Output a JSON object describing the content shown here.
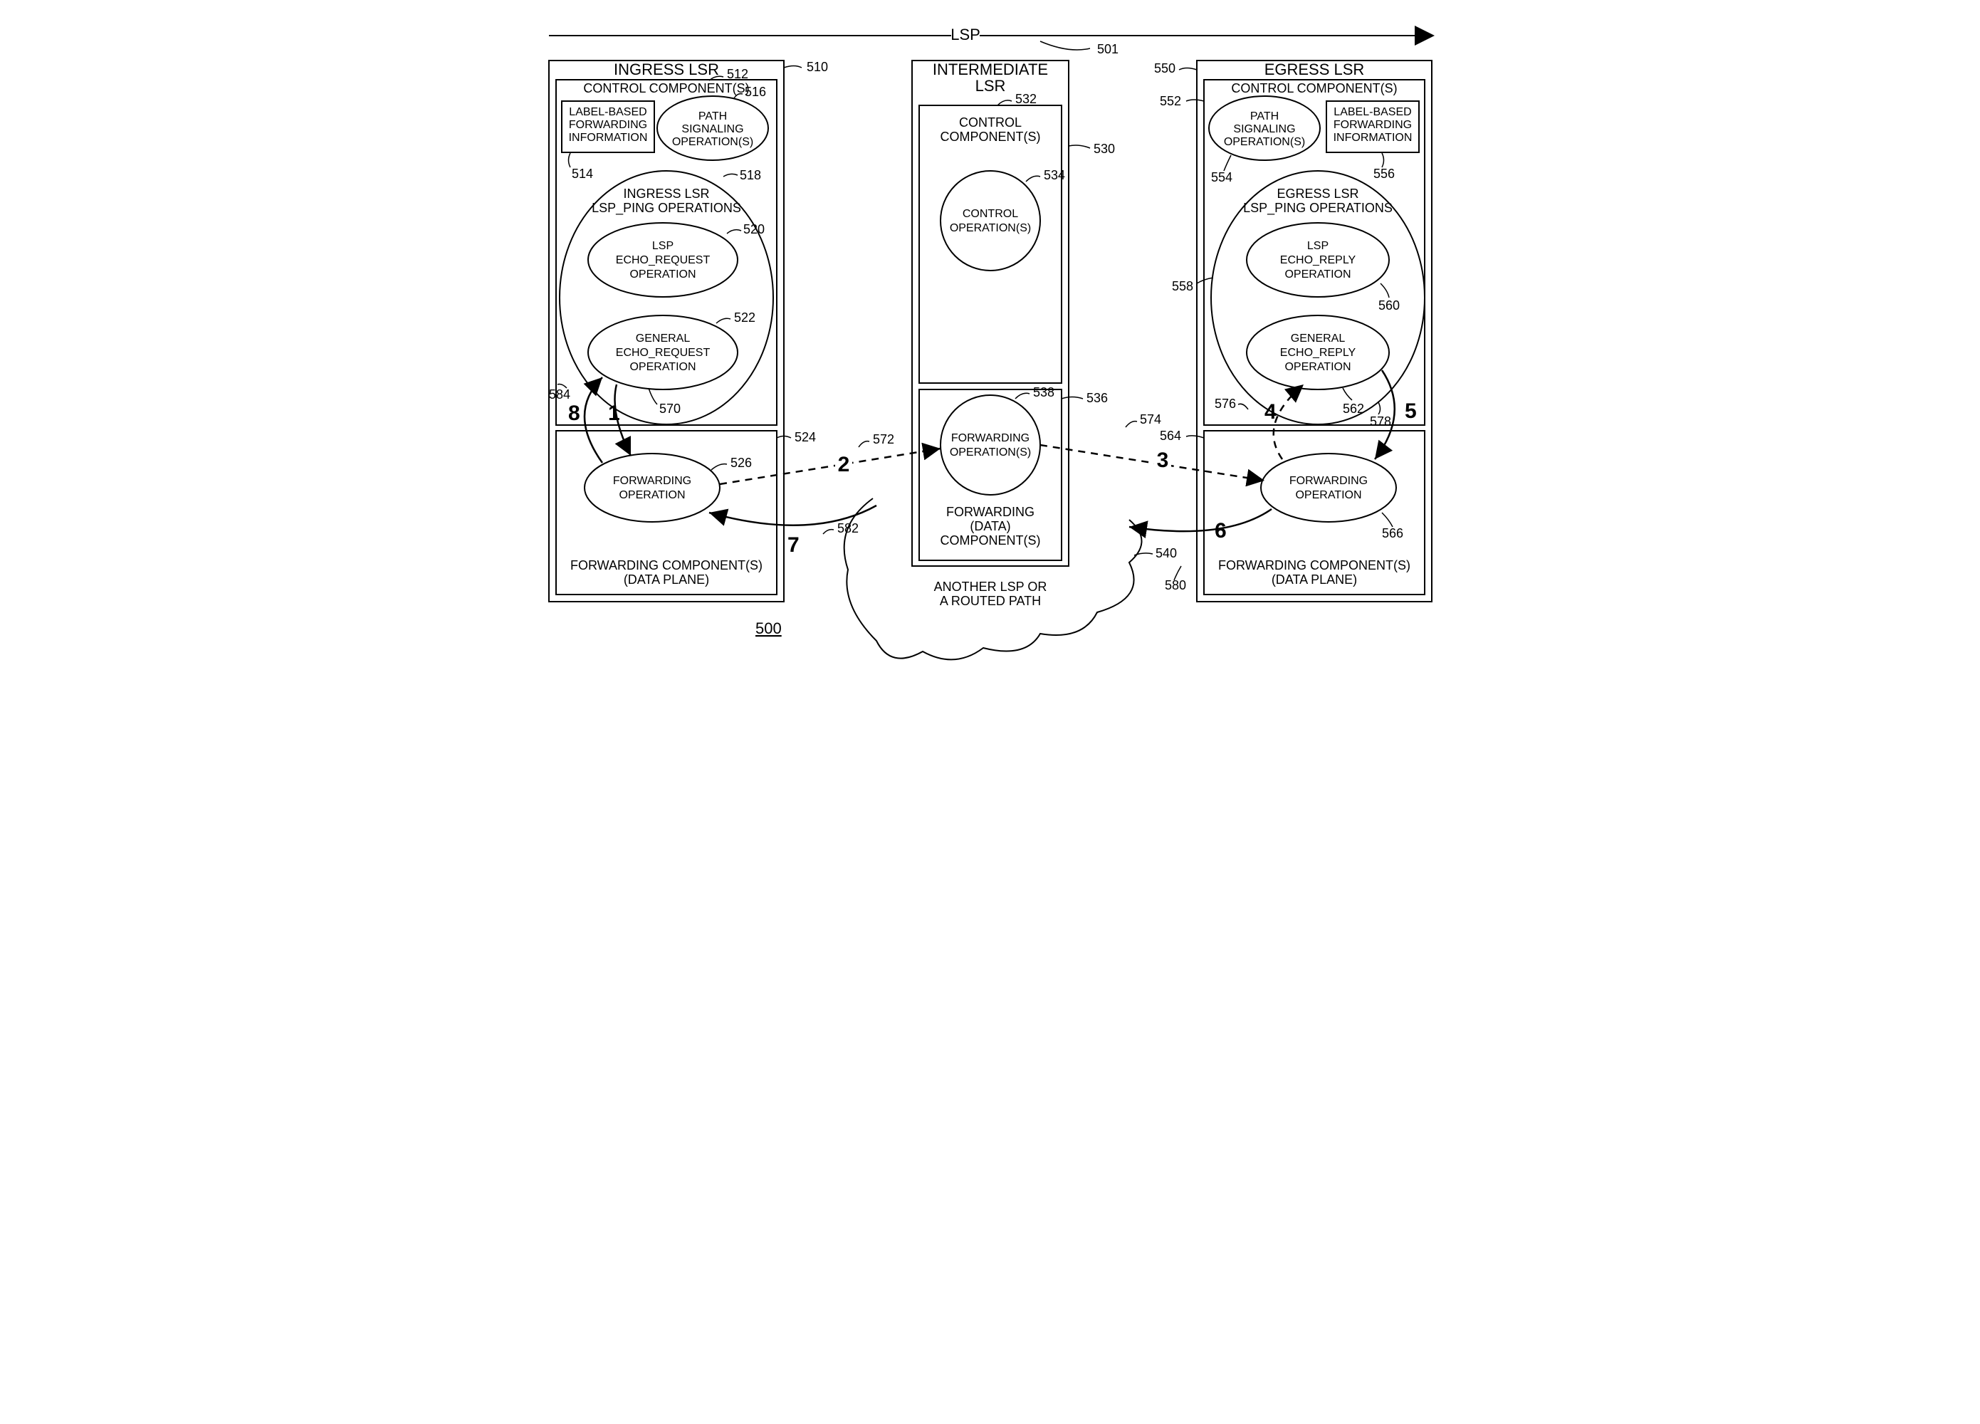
{
  "header": {
    "lsp_label": "LSP"
  },
  "ingress": {
    "title": "INGRESS LSR",
    "control_title": "CONTROL COMPONENT(S)",
    "label_fwd": [
      "LABEL-BASED",
      "FORWARDING",
      "INFORMATION"
    ],
    "path_sig": [
      "PATH",
      "SIGNALING",
      "OPERATION(S)"
    ],
    "ping_ops": [
      "INGRESS LSR",
      "LSP_PING OPERATIONS"
    ],
    "echo_req": [
      "LSP",
      "ECHO_REQUEST",
      "OPERATION"
    ],
    "gen_echo_req": [
      "GENERAL",
      "ECHO_REQUEST",
      "OPERATION"
    ],
    "fwd_op": [
      "FORWARDING",
      "OPERATION"
    ],
    "fwd_comp": [
      "FORWARDING COMPONENT(S)",
      "(DATA PLANE)"
    ]
  },
  "intermediate": {
    "title": [
      "INTERMEDIATE",
      "LSR"
    ],
    "control_title": [
      "CONTROL",
      "COMPONENT(S)"
    ],
    "control_op": [
      "CONTROL",
      "OPERATION(S)"
    ],
    "fwd_op": [
      "FORWARDING",
      "OPERATION(S)"
    ],
    "fwd_comp": [
      "FORWARDING",
      "(DATA)",
      "COMPONENT(S)"
    ]
  },
  "egress": {
    "title": "EGRESS LSR",
    "control_title": "CONTROL COMPONENT(S)",
    "label_fwd": [
      "LABEL-BASED",
      "FORWARDING",
      "INFORMATION"
    ],
    "path_sig": [
      "PATH",
      "SIGNALING",
      "OPERATION(S)"
    ],
    "ping_ops": [
      "EGRESS LSR",
      "LSP_PING OPERATIONS"
    ],
    "echo_reply": [
      "LSP",
      "ECHO_REPLY",
      "OPERATION"
    ],
    "gen_echo_reply": [
      "GENERAL",
      "ECHO_REPLY",
      "OPERATION"
    ],
    "fwd_op": [
      "FORWARDING",
      "OPERATION"
    ],
    "fwd_comp": [
      "FORWARDING COMPONENT(S)",
      "(DATA PLANE)"
    ]
  },
  "other": {
    "another_lsp": [
      "ANOTHER LSP OR",
      "A ROUTED PATH"
    ],
    "fig_num": "500"
  },
  "refs": {
    "r501": "501",
    "r510": "510",
    "r512": "512",
    "r514": "514",
    "r516": "516",
    "r518": "518",
    "r520": "520",
    "r522": "522",
    "r524": "524",
    "r526": "526",
    "r530": "530",
    "r532": "532",
    "r534": "534",
    "r536": "536",
    "r538": "538",
    "r540": "540",
    "r550": "550",
    "r552": "552",
    "r554": "554",
    "r556": "556",
    "r558": "558",
    "r560": "560",
    "r562": "562",
    "r564": "564",
    "r566": "566",
    "r570": "570",
    "r572": "572",
    "r574": "574",
    "r576": "576",
    "r578": "578",
    "r580": "580",
    "r582": "582",
    "r584": "584"
  },
  "steps": {
    "s1": "1",
    "s2": "2",
    "s3": "3",
    "s4": "4",
    "s5": "5",
    "s6": "6",
    "s7": "7",
    "s8": "8"
  }
}
